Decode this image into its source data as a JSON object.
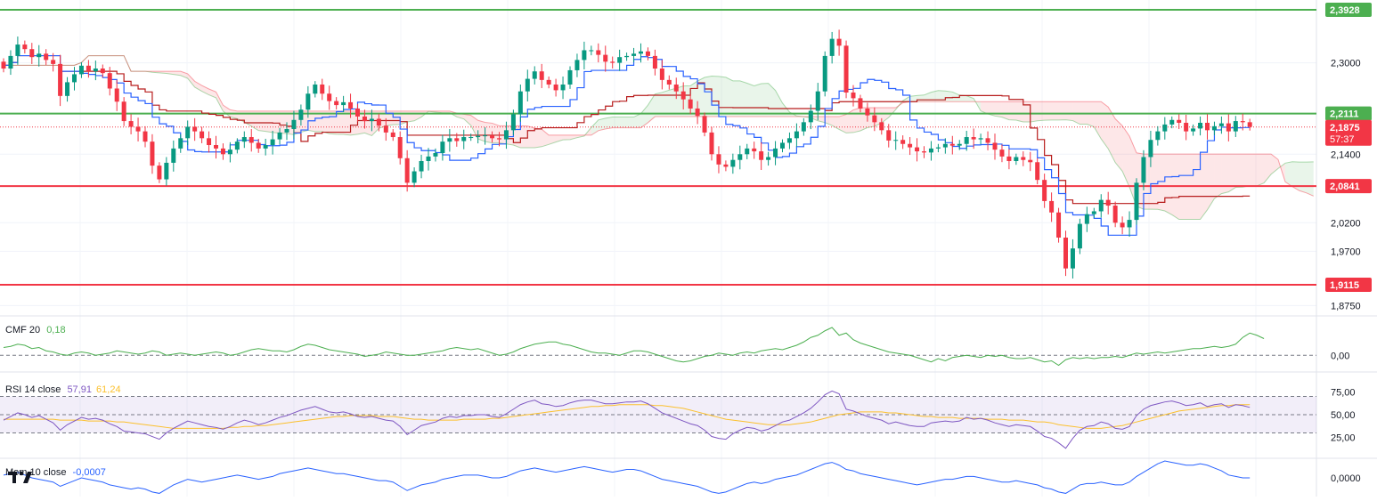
{
  "chart_data": [
    {
      "type": "candlestick",
      "pane": "price",
      "price_axis": {
        "ticks": [
          "2,3000",
          "2,1400",
          "2,0200",
          "1,9700",
          "1,8750"
        ],
        "ticks_value": [
          2.3,
          2.14,
          2.02,
          1.97,
          1.875
        ],
        "ylim": [
          1.86,
          2.41
        ]
      },
      "horizontal_levels": [
        {
          "label": "2,3928",
          "value": 2.3928,
          "color": "#4caf50"
        },
        {
          "label": "2,2111",
          "value": 2.2111,
          "color": "#4caf50"
        },
        {
          "label": "2,0841",
          "value": 2.0841,
          "color": "#f23645"
        },
        {
          "label": "1,9115",
          "value": 1.9115,
          "color": "#f23645"
        }
      ],
      "last_price": {
        "label": "2,1875",
        "value": 2.1875,
        "countdown": "57:37",
        "color": "#f23645"
      },
      "colors": {
        "up": "#089981",
        "down": "#f23645",
        "tenkan": "#2962ff",
        "kijun": "#b71c1c",
        "cloud_bull": "#4caf50",
        "cloud_bear": "#f23645"
      },
      "close": [
        2.29,
        2.312,
        2.332,
        2.324,
        2.31,
        2.316,
        2.305,
        2.298,
        2.242,
        2.266,
        2.28,
        2.295,
        2.285,
        2.29,
        2.282,
        2.255,
        2.232,
        2.198,
        2.188,
        2.18,
        2.162,
        2.12,
        2.096,
        2.125,
        2.15,
        2.168,
        2.188,
        2.18,
        2.168,
        2.156,
        2.15,
        2.14,
        2.148,
        2.162,
        2.17,
        2.16,
        2.15,
        2.156,
        2.166,
        2.178,
        2.184,
        2.2,
        2.218,
        2.246,
        2.262,
        2.246,
        2.233,
        2.226,
        2.231,
        2.22,
        2.206,
        2.198,
        2.202,
        2.19,
        2.178,
        2.17,
        2.133,
        2.09,
        2.11,
        2.128,
        2.136,
        2.142,
        2.162,
        2.168,
        2.163,
        2.17,
        2.17,
        2.172,
        2.173,
        2.168,
        2.166,
        2.182,
        2.21,
        2.25,
        2.272,
        2.285,
        2.27,
        2.262,
        2.252,
        2.262,
        2.287,
        2.305,
        2.322,
        2.322,
        2.314,
        2.302,
        2.3,
        2.31,
        2.312,
        2.316,
        2.32,
        2.312,
        2.29,
        2.27,
        2.262,
        2.25,
        2.236,
        2.22,
        2.207,
        2.178,
        2.14,
        2.122,
        2.118,
        2.13,
        2.14,
        2.15,
        2.145,
        2.13,
        2.135,
        2.15,
        2.16,
        2.168,
        2.18,
        2.196,
        2.216,
        2.25,
        2.312,
        2.342,
        2.33,
        2.248,
        2.238,
        2.22,
        2.208,
        2.196,
        2.182,
        2.164,
        2.165,
        2.158,
        2.152,
        2.145,
        2.143,
        2.15,
        2.152,
        2.158,
        2.155,
        2.158,
        2.17,
        2.166,
        2.168,
        2.16,
        2.148,
        2.136,
        2.128,
        2.135,
        2.13,
        2.126,
        2.095,
        2.058,
        2.038,
        1.994,
        1.94,
        1.975,
        2.018,
        2.035,
        2.04,
        2.06,
        2.05,
        2.02,
        2.012,
        2.025,
        2.09,
        2.135,
        2.165,
        2.18,
        2.192,
        2.2,
        2.195,
        2.18,
        2.185,
        2.195,
        2.182,
        2.189,
        2.194,
        2.18,
        2.198,
        2.196,
        2.188
      ],
      "pane_cmf": {
        "label": "CMF 20",
        "value": "0,18",
        "color": "#4caf50",
        "ticks": [
          "0,00"
        ],
        "ticks_value": [
          0.0
        ],
        "ylim": [
          -0.15,
          0.33
        ],
        "values": [
          0.07,
          0.08,
          0.1,
          0.09,
          0.06,
          0.07,
          0.04,
          0.03,
          0.01,
          0.0,
          0.02,
          0.03,
          0.02,
          0.0,
          0.01,
          0.02,
          0.04,
          0.03,
          0.02,
          0.01,
          0.02,
          0.04,
          0.03,
          0.0,
          0.01,
          0.02,
          0.01,
          0.0,
          0.01,
          0.02,
          0.03,
          0.02,
          0.0,
          0.01,
          0.03,
          0.05,
          0.06,
          0.05,
          0.04,
          0.04,
          0.03,
          0.05,
          0.08,
          0.1,
          0.09,
          0.07,
          0.05,
          0.04,
          0.03,
          0.02,
          0.01,
          -0.01,
          0.0,
          0.01,
          0.03,
          0.02,
          0.01,
          0.0,
          0.0,
          0.01,
          0.02,
          0.03,
          0.04,
          0.06,
          0.07,
          0.06,
          0.05,
          0.06,
          0.04,
          0.02,
          0.0,
          0.01,
          0.03,
          0.06,
          0.08,
          0.1,
          0.11,
          0.12,
          0.12,
          0.1,
          0.09,
          0.07,
          0.05,
          0.03,
          0.02,
          0.02,
          0.01,
          0.0,
          0.02,
          0.04,
          0.04,
          0.03,
          0.01,
          -0.01,
          -0.03,
          -0.05,
          -0.06,
          -0.05,
          -0.03,
          -0.01,
          0.0,
          0.02,
          0.01,
          0.0,
          0.02,
          0.03,
          0.02,
          0.04,
          0.05,
          0.06,
          0.05,
          0.07,
          0.09,
          0.12,
          0.16,
          0.18,
          0.22,
          0.25,
          0.18,
          0.2,
          0.14,
          0.11,
          0.09,
          0.07,
          0.05,
          0.03,
          0.02,
          0.01,
          0.0,
          -0.02,
          -0.04,
          -0.06,
          -0.03,
          -0.05,
          -0.02,
          -0.01,
          0.0,
          -0.01,
          -0.02,
          0.0,
          -0.01,
          0.0,
          -0.02,
          -0.03,
          -0.03,
          -0.02,
          -0.04,
          -0.06,
          -0.05,
          -0.09,
          -0.04,
          -0.02,
          -0.03,
          -0.02,
          -0.03,
          -0.02,
          -0.02,
          -0.01,
          -0.02,
          0.0,
          0.02,
          0.01,
          0.02,
          0.03,
          0.02,
          0.03,
          0.04,
          0.05,
          0.06,
          0.06,
          0.07,
          0.08,
          0.07,
          0.08,
          0.1,
          0.16,
          0.2,
          0.18,
          0.15
        ]
      },
      "pane_rsi": {
        "label": "RSI 14 close",
        "value": "57,91",
        "ma_value": "61,24",
        "color": "#7e57c2",
        "ma_color": "#fbc02d",
        "ticks": [
          "75,00",
          "50,00",
          "25,00"
        ],
        "ticks_value": [
          75,
          50,
          25
        ],
        "ylim": [
          5,
          95
        ],
        "band": [
          70,
          30
        ],
        "mid": 50,
        "values": [
          44,
          48,
          52,
          50,
          47,
          49,
          45,
          41,
          33,
          39,
          43,
          47,
          45,
          46,
          44,
          40,
          37,
          32,
          31,
          30,
          29,
          26,
          23,
          30,
          35,
          39,
          43,
          41,
          39,
          37,
          36,
          34,
          37,
          41,
          44,
          42,
          39,
          41,
          44,
          47,
          49,
          52,
          55,
          57,
          59,
          56,
          53,
          52,
          53,
          51,
          48,
          47,
          48,
          46,
          44,
          43,
          37,
          28,
          33,
          38,
          40,
          42,
          46,
          48,
          47,
          49,
          49,
          50,
          50,
          48,
          47,
          51,
          56,
          61,
          64,
          66,
          62,
          61,
          59,
          60,
          63,
          65,
          66,
          66,
          64,
          62,
          62,
          63,
          64,
          64,
          65,
          62,
          57,
          52,
          49,
          46,
          43,
          40,
          38,
          33,
          26,
          24,
          23,
          29,
          33,
          36,
          35,
          32,
          34,
          38,
          42,
          44,
          48,
          52,
          57,
          64,
          72,
          76,
          73,
          56,
          54,
          51,
          48,
          46,
          44,
          40,
          42,
          40,
          38,
          37,
          37,
          41,
          42,
          43,
          42,
          43,
          47,
          45,
          46,
          44,
          41,
          39,
          37,
          39,
          38,
          37,
          32,
          26,
          24,
          19,
          13,
          24,
          33,
          37,
          38,
          42,
          40,
          35,
          34,
          37,
          49,
          56,
          60,
          62,
          64,
          65,
          63,
          60,
          61,
          63,
          59,
          61,
          62,
          58,
          61,
          60,
          58
        ],
        "ma_values": [
          45,
          45,
          45,
          45,
          45,
          45,
          45,
          45,
          44,
          44,
          44,
          44,
          43,
          43,
          43,
          43,
          42,
          42,
          41,
          40,
          39,
          38,
          37,
          36,
          35,
          35,
          35,
          35,
          35,
          35,
          35,
          35,
          36,
          36,
          37,
          37,
          38,
          38,
          39,
          40,
          41,
          42,
          43,
          44,
          45,
          46,
          47,
          48,
          48,
          49,
          49,
          49,
          49,
          48,
          48,
          48,
          47,
          46,
          45,
          45,
          44,
          44,
          44,
          44,
          44,
          45,
          45,
          45,
          45,
          46,
          46,
          47,
          48,
          49,
          50,
          51,
          52,
          53,
          54,
          55,
          56,
          57,
          58,
          59,
          59,
          60,
          60,
          61,
          61,
          61,
          61,
          61,
          60,
          60,
          59,
          58,
          57,
          55,
          53,
          51,
          49,
          47,
          45,
          44,
          43,
          42,
          41,
          40,
          39,
          39,
          39,
          39,
          40,
          41,
          42,
          44,
          46,
          48,
          50,
          51,
          52,
          53,
          53,
          53,
          53,
          52,
          52,
          51,
          50,
          49,
          48,
          48,
          47,
          47,
          47,
          46,
          46,
          46,
          46,
          45,
          45,
          45,
          44,
          44,
          44,
          43,
          42,
          42,
          41,
          39,
          38,
          37,
          36,
          35,
          35,
          35,
          36,
          37,
          38,
          40,
          42,
          44,
          46,
          48,
          50,
          52,
          54,
          55,
          56,
          57,
          58,
          59,
          60,
          60,
          61,
          61,
          61
        ]
      },
      "pane_mom": {
        "label": "Mom 10 close",
        "value": "-0,0007",
        "color": "#2962ff",
        "ticks": [
          "0,0000"
        ],
        "ticks_value": [
          0.0
        ],
        "ylim": [
          -0.12,
          0.12
        ],
        "values": [
          0.02,
          0.03,
          0.04,
          0.02,
          0.0,
          -0.01,
          -0.02,
          -0.03,
          -0.06,
          -0.04,
          -0.02,
          0.0,
          -0.01,
          -0.02,
          -0.03,
          -0.05,
          -0.06,
          -0.07,
          -0.08,
          -0.07,
          -0.08,
          -0.1,
          -0.11,
          -0.08,
          -0.05,
          -0.03,
          -0.01,
          -0.02,
          -0.03,
          -0.02,
          -0.01,
          0.0,
          0.01,
          0.02,
          0.01,
          0.0,
          -0.01,
          0.0,
          0.01,
          0.03,
          0.04,
          0.05,
          0.06,
          0.07,
          0.06,
          0.05,
          0.04,
          0.03,
          0.03,
          0.02,
          0.01,
          0.0,
          -0.01,
          -0.02,
          -0.02,
          -0.03,
          -0.06,
          -0.09,
          -0.07,
          -0.05,
          -0.04,
          -0.03,
          -0.01,
          0.0,
          0.01,
          0.02,
          0.02,
          0.02,
          0.01,
          0.0,
          0.0,
          0.01,
          0.03,
          0.05,
          0.06,
          0.07,
          0.06,
          0.05,
          0.04,
          0.05,
          0.06,
          0.07,
          0.08,
          0.07,
          0.06,
          0.05,
          0.04,
          0.05,
          0.06,
          0.06,
          0.05,
          0.03,
          0.01,
          -0.01,
          -0.02,
          -0.03,
          -0.04,
          -0.05,
          -0.06,
          -0.08,
          -0.1,
          -0.11,
          -0.1,
          -0.08,
          -0.06,
          -0.04,
          -0.03,
          -0.04,
          -0.03,
          -0.01,
          0.0,
          0.01,
          0.02,
          0.04,
          0.06,
          0.08,
          0.1,
          0.11,
          0.09,
          0.06,
          0.05,
          0.03,
          0.02,
          0.01,
          0.0,
          -0.01,
          -0.02,
          -0.03,
          -0.04,
          -0.05,
          -0.04,
          -0.03,
          -0.02,
          -0.01,
          -0.01,
          0.0,
          0.01,
          0.01,
          0.0,
          -0.01,
          -0.02,
          -0.03,
          -0.03,
          -0.02,
          -0.03,
          -0.04,
          -0.05,
          -0.07,
          -0.08,
          -0.1,
          -0.11,
          -0.08,
          -0.05,
          -0.04,
          -0.04,
          -0.03,
          -0.04,
          -0.05,
          -0.05,
          -0.03,
          0.01,
          0.04,
          0.07,
          0.1,
          0.12,
          0.11,
          0.1,
          0.09,
          0.09,
          0.1,
          0.09,
          0.07,
          0.05,
          0.02,
          0.01,
          0.0,
          0.0
        ]
      }
    }
  ]
}
